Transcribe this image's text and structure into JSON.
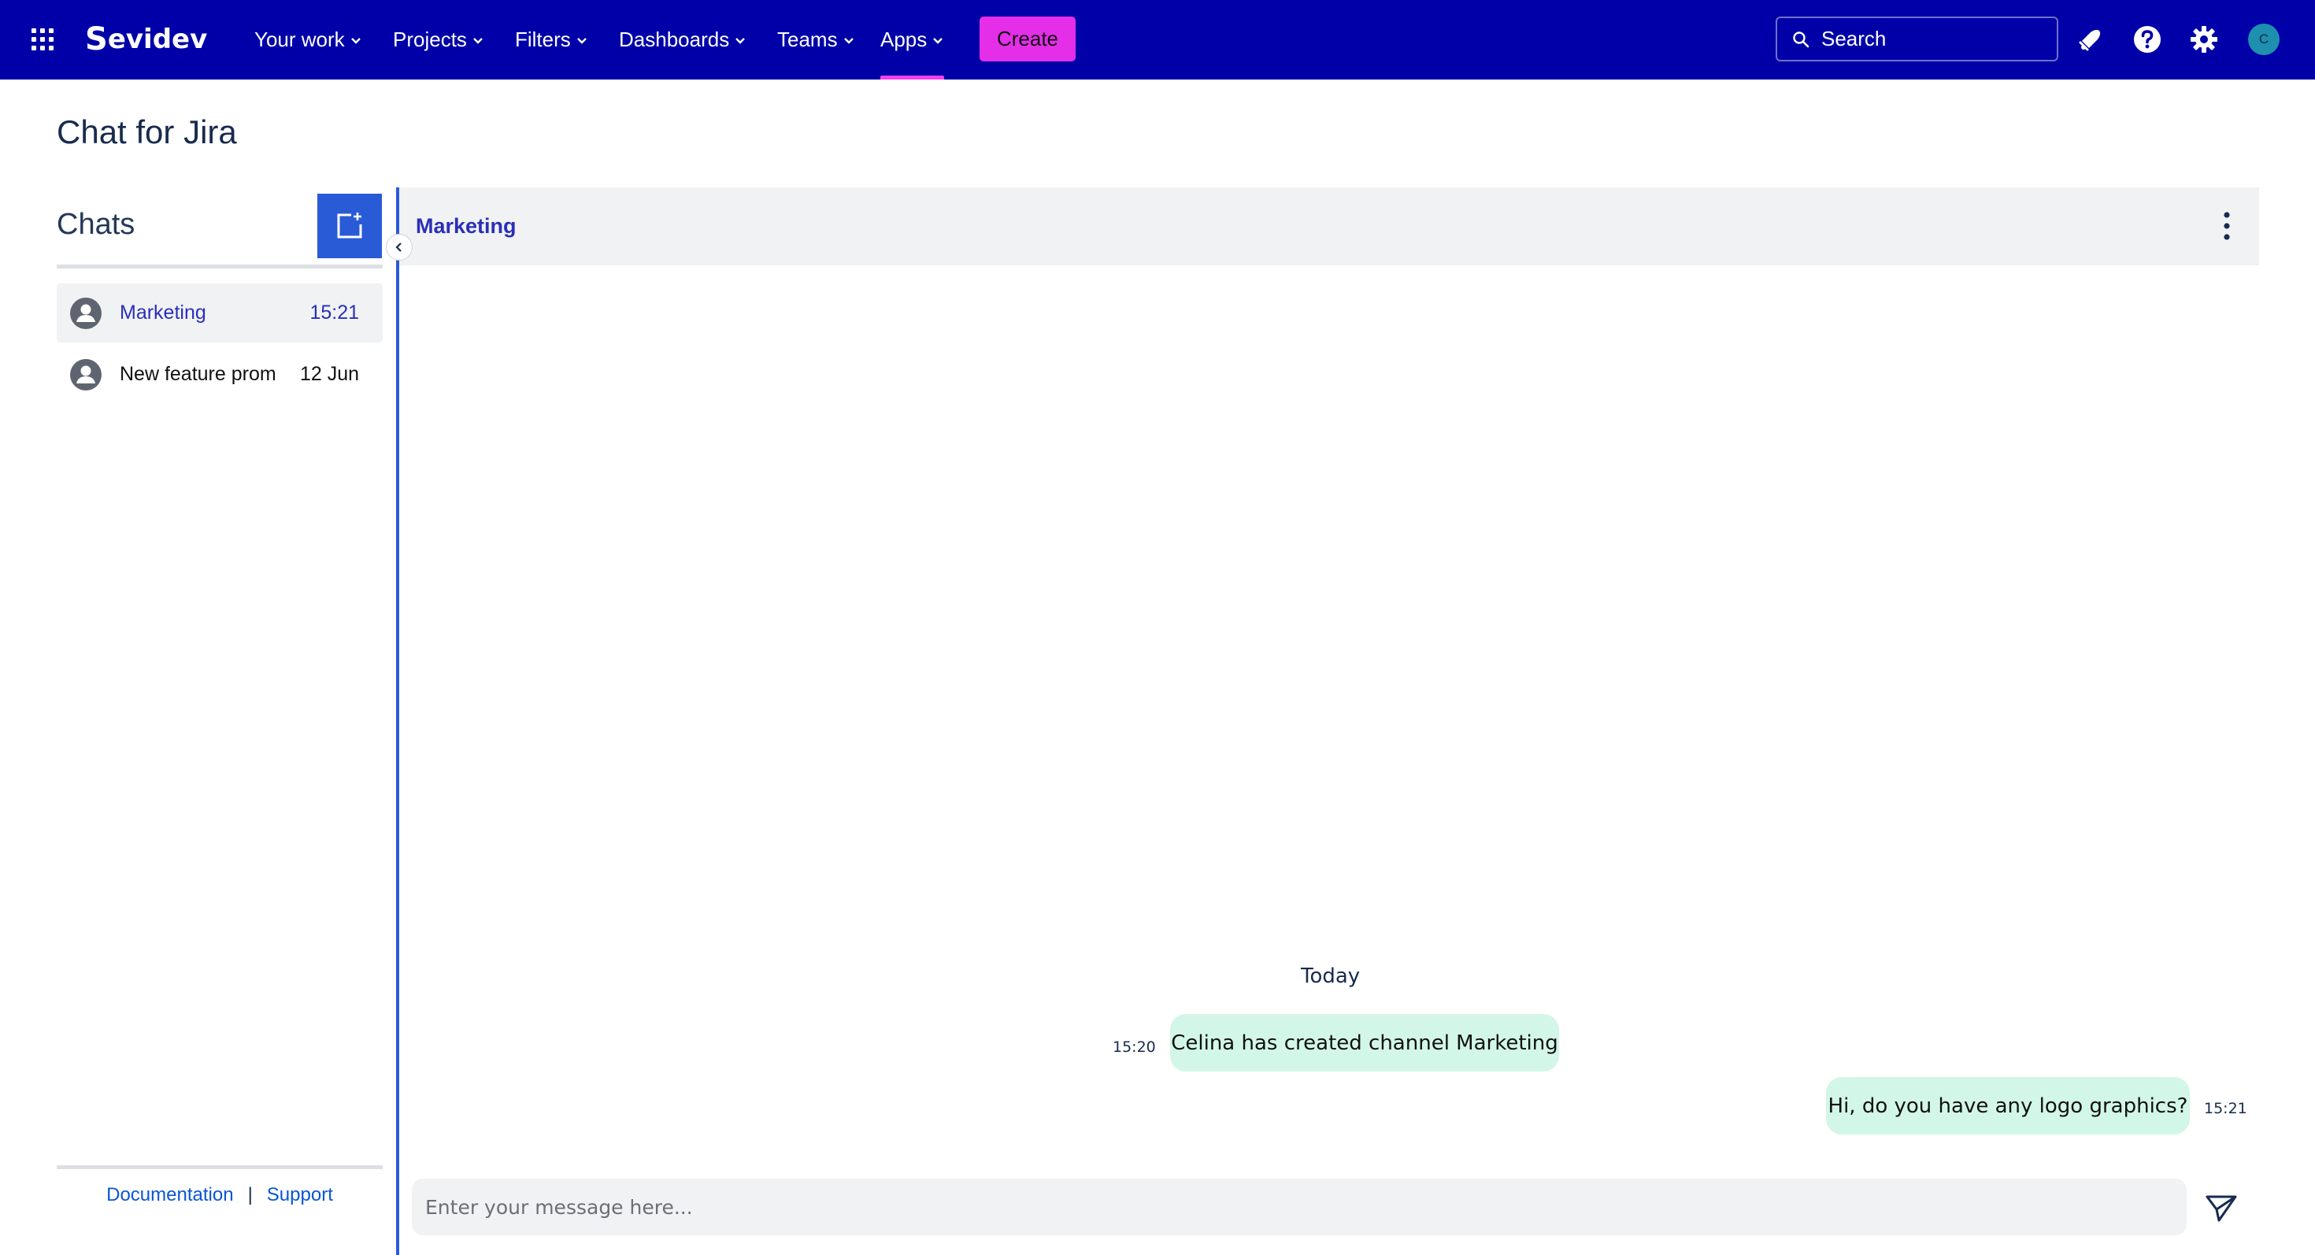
{
  "nav": {
    "logo_text": "evidev",
    "logo_mark": "S",
    "menus": [
      {
        "label": "Your work"
      },
      {
        "label": "Projects"
      },
      {
        "label": "Filters"
      },
      {
        "label": "Dashboards"
      },
      {
        "label": "Teams"
      },
      {
        "label": "Apps",
        "active": true
      }
    ],
    "create_label": "Create",
    "search_placeholder": "Search",
    "avatar_initial": "C",
    "colors": {
      "bar": "#0000a8",
      "create": "#e42ee8",
      "active_underline": "#f040f0",
      "avatar": "#1f8fb0"
    }
  },
  "page": {
    "title": "Chat for Jira"
  },
  "sidebar": {
    "heading": "Chats",
    "chats": [
      {
        "name": "Marketing",
        "time": "15:21",
        "selected": true
      },
      {
        "name": "New feature prom",
        "time": "12 Jun",
        "selected": false
      }
    ],
    "footer": {
      "documentation": "Documentation",
      "separator": "|",
      "support": "Support"
    }
  },
  "chat": {
    "channel": "Marketing",
    "day_label": "Today",
    "messages": [
      {
        "time": "15:20",
        "text": "Celina has created channel Marketing",
        "side": "left"
      },
      {
        "time": "15:21",
        "text": "Hi, do you have any logo graphics?",
        "side": "right"
      }
    ],
    "composer_placeholder": "Enter your message here...",
    "bubble_color": "#d2f7e8",
    "accent": "#2a5bd7"
  },
  "icons": [
    "app-grid-icon",
    "chevron-down-icon",
    "search-icon",
    "notification-icon",
    "help-icon",
    "settings-icon",
    "new-chat-icon",
    "person-icon",
    "chevron-left-icon",
    "more-vertical-icon",
    "send-icon"
  ]
}
